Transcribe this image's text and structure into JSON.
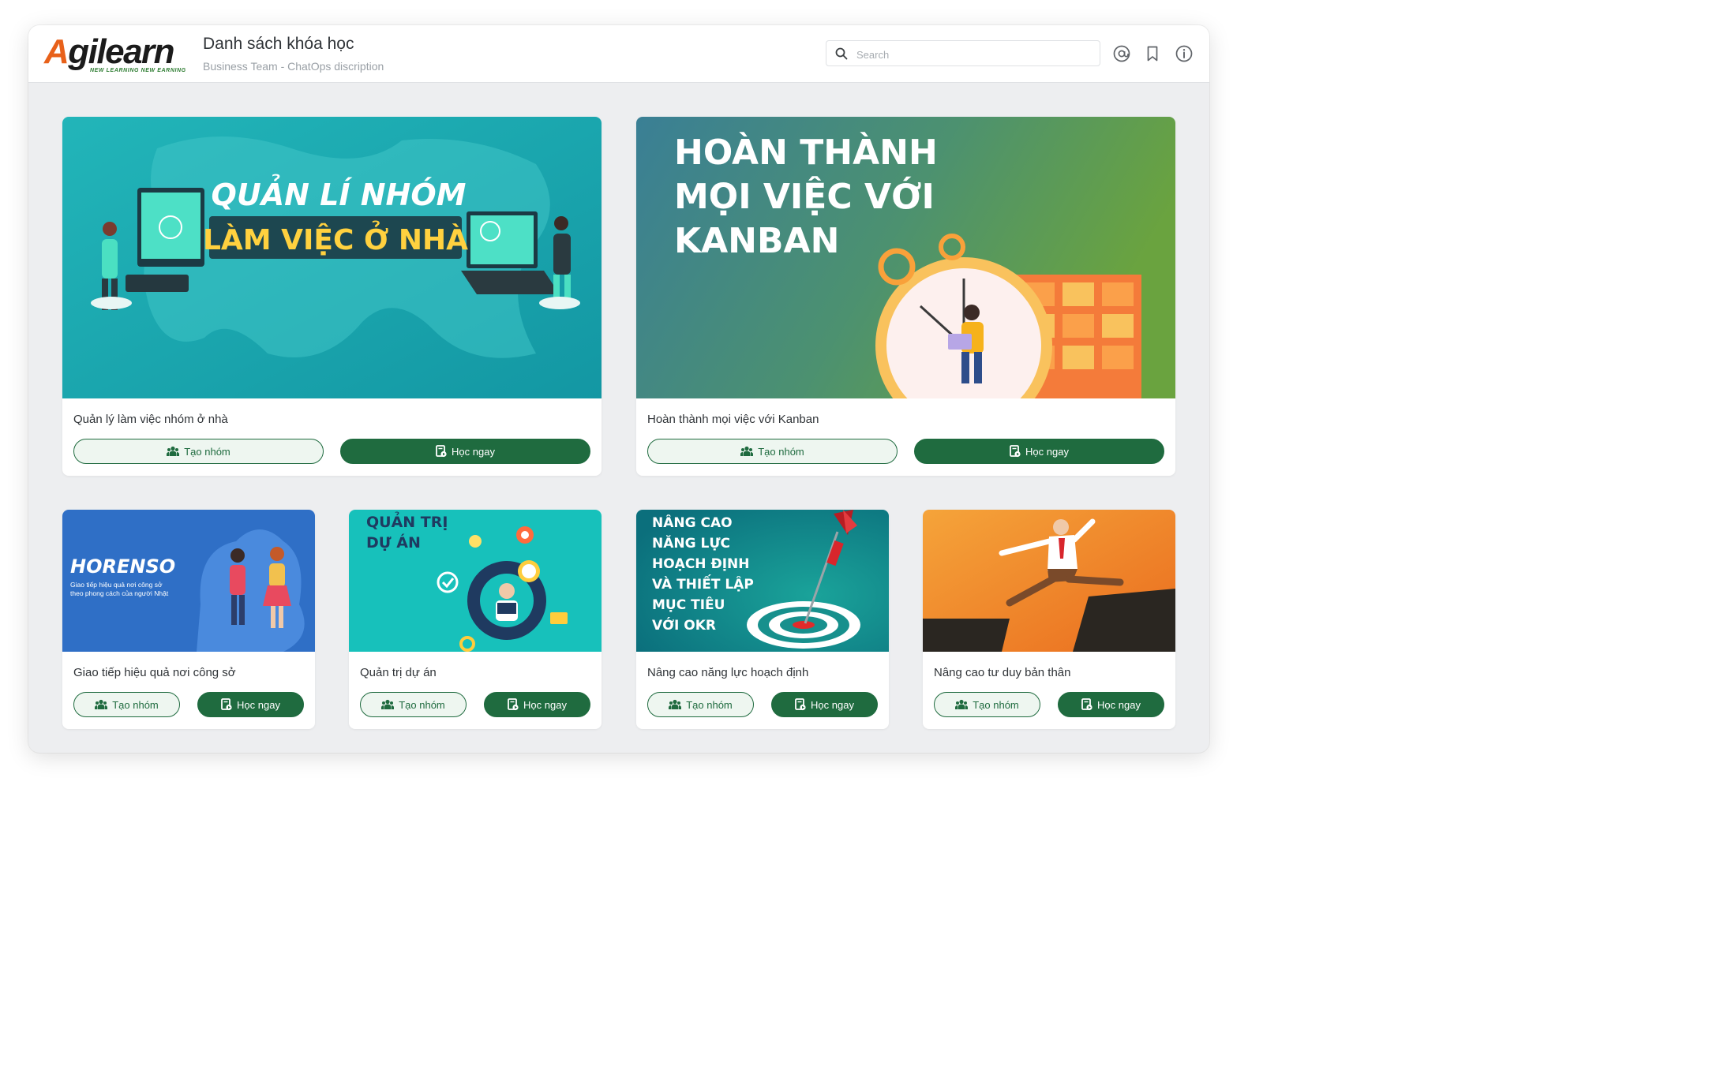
{
  "header": {
    "logo_text": "Agilearn",
    "logo_tagline": "NEW LEARNING NEW EARNING",
    "title": "Danh sách khóa học",
    "subtitle": "Business Team - ChatOps discription",
    "search_placeholder": "Search",
    "icons": [
      "search-icon",
      "mention-icon",
      "bookmark-icon",
      "info-icon"
    ]
  },
  "buttons": {
    "create_group": "Tạo nhóm",
    "learn_now": "Học ngay"
  },
  "colors": {
    "primary": "#1f6b3f",
    "outline_bg": "#eef6f0",
    "page_bg": "#edeef0"
  },
  "courses": [
    {
      "title": "Quản lý làm việc nhóm ở nhà",
      "banner_line1": "QUẢN LÍ NHÓM",
      "banner_line2": "LÀM VIỆC Ở NHÀ"
    },
    {
      "title": "Hoàn thành mọi việc với Kanban",
      "banner_line1": "HOÀN THÀNH",
      "banner_line2": "MỌI VIỆC VỚI",
      "banner_line3": "KANBAN"
    },
    {
      "title": "Giao tiếp hiệu quả nơi công sở",
      "banner_line1": "HORENSO",
      "banner_line2": "Giao tiếp hiệu quả nơi công sở",
      "banner_line3": "theo phong cách của người Nhật"
    },
    {
      "title": "Quản trị dự án",
      "banner_line1": "QUẢN TRỊ",
      "banner_line2": "DỰ ÁN"
    },
    {
      "title": "Nâng cao năng lực hoạch định",
      "banner_line1": "NÂNG CAO",
      "banner_line2": "NĂNG LỰC",
      "banner_line3": "HOẠCH ĐỊNH",
      "banner_line4": "VÀ THIẾT LẬP",
      "banner_line5": "MỤC TIÊU",
      "banner_line6": "VỚI OKR"
    },
    {
      "title": "Nâng cao tư duy bản thân"
    }
  ]
}
